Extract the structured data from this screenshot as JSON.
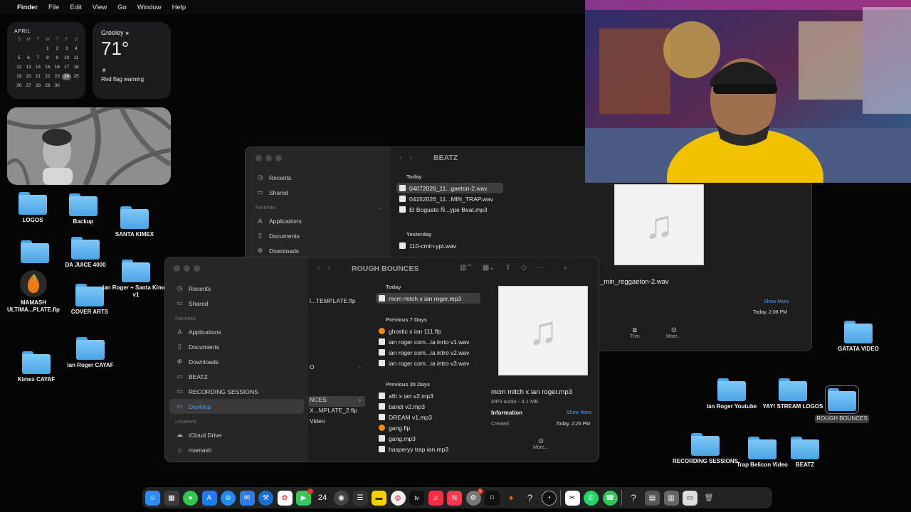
{
  "menubar": {
    "apple": "",
    "items": [
      "Finder",
      "File",
      "Edit",
      "View",
      "Go",
      "Window",
      "Help"
    ]
  },
  "calendar": {
    "month": "APRIL",
    "weekdays": [
      "S",
      "M",
      "T",
      "W",
      "T",
      "F",
      "S"
    ],
    "weeks": [
      [
        "",
        "",
        "",
        "1",
        "2",
        "3",
        "4"
      ],
      [
        "5",
        "6",
        "7",
        "8",
        "9",
        "10",
        "11"
      ],
      [
        "12",
        "13",
        "14",
        "15",
        "16",
        "17",
        "18"
      ],
      [
        "19",
        "20",
        "21",
        "22",
        "23",
        "24",
        "25"
      ],
      [
        "26",
        "27",
        "28",
        "29",
        "30",
        "",
        ""
      ]
    ],
    "today": "24"
  },
  "weather": {
    "city": "Greeley",
    "temp": "71°",
    "warning": "Red flag warning"
  },
  "desktop_icons": [
    {
      "label": "LOGOS"
    },
    {
      "label": "Backup"
    },
    {
      "label": "SANTA KIMEX"
    },
    {
      "label": "DA JUICE 4000"
    },
    {
      "label": "MAMASH ULTIMA...PLATE.flp"
    },
    {
      "label": "COVER ARTS"
    },
    {
      "label": "Ian Roger + Santa Kimex v1"
    },
    {
      "label": "Ian Roger CAYAF"
    },
    {
      "label": "Kimex CAYAF"
    },
    {
      "label": "GATATA VIDEO"
    },
    {
      "label": "Ian Roger Youtube"
    },
    {
      "label": "YAY! STREAM LOGOS"
    },
    {
      "label": "ROUGH BOUNCES"
    },
    {
      "label": "RECORDING SESSIONS"
    },
    {
      "label": "Trap Belicon Video"
    },
    {
      "label": "BEATZ"
    }
  ],
  "back_window": {
    "title": "BEATZ",
    "sidebar": {
      "recents": "Recents",
      "shared": "Shared",
      "favorites_head": "Favorites",
      "applications": "Applications",
      "documents": "Documents",
      "downloads": "Downloads"
    },
    "today_head": "Today",
    "today_files": [
      "04072026_11...gaeton-2.wav",
      "04152026_11...MIN_TRAP.wav",
      "El Bogueto  Ñ...ype Beat.mp3"
    ],
    "yesterday_head": "Yesterday",
    "yesterday_files": [
      "110-cmin-ypt.wav"
    ],
    "preview": {
      "filename": "_min_reggaeton-2.wav",
      "show_more": "Show More",
      "date": "Today, 2:08 PM",
      "trim": "Trim",
      "more": "More..."
    }
  },
  "front_window": {
    "title": "ROUGH BOUNCES",
    "sidebar": {
      "recents": "Recents",
      "shared": "Shared",
      "favorites_head": "Favorites",
      "applications": "Applications",
      "documents": "Documents",
      "downloads": "Downloads",
      "beatz": "BEATZ",
      "recording": "RECORDING SESSIONS",
      "desktop": "Desktop",
      "locations_head": "Locations",
      "icloud": "iCloud Drive",
      "mamash": "mamash"
    },
    "col1": [
      "l...TEMPLATE.flp",
      "O",
      "NCES",
      "X...MPLATE_2.flp",
      "Video"
    ],
    "today_head": "Today",
    "today_files": [
      "mcm mitch x ian roger.mp3"
    ],
    "prev7_head": "Previous 7 Days",
    "prev7_files": [
      "ghostic x ian 111.flp",
      "ian roger com...ia inrto v1.wav",
      "ian roger com...ia intro v2.wav",
      "ian roger com...ia intro v3.wav"
    ],
    "prev30_head": "Previous 30 Days",
    "prev30_files": [
      "aftr x ian v2.mp3",
      "bandi v2.mp3",
      "DREAM v1.mp3",
      "gang.flp",
      "gang.mp3",
      "hasperyy trap ian.mp3"
    ],
    "preview": {
      "filename": "mcm mitch x ian roger.mp3",
      "meta": "MP3 audio - 4.1 MB",
      "info_head": "Information",
      "show_more": "Show More",
      "created_label": "Created",
      "created_value": "Today, 2:26 PM",
      "more": "More..."
    }
  },
  "dock": {
    "apps": [
      "finder-icon",
      "launchpad-icon",
      "messages-icon",
      "app-store-icon",
      "safari-icon",
      "mail-icon",
      "xcode-icon",
      "photos-icon",
      "facetime-icon",
      "calendar-icon",
      "system-icon",
      "notes-icon",
      "stickies-icon",
      "chrome-icon",
      "apple-tv-icon",
      "music-icon",
      "news-icon",
      "settings-icon",
      "audio-app-icon",
      "fl-studio-icon",
      "unknown-icon",
      "obs-icon"
    ],
    "calendar_day": "24",
    "tv_label": "tv",
    "settings_badge": "1"
  }
}
